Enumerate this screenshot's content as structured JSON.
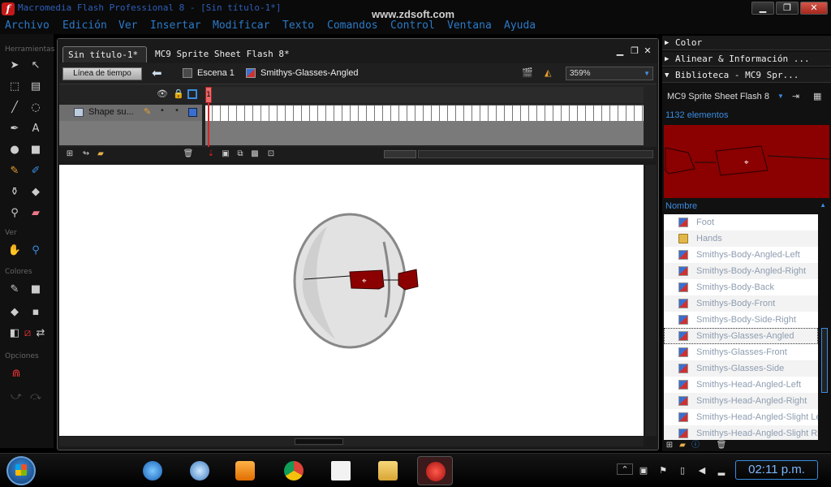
{
  "window": {
    "title": "Macromedia Flash Professional 8 - [Sin título-1*]",
    "watermark": "www.zdsoft.com",
    "min_label": "▁",
    "max_label": "❐",
    "close_label": "✕"
  },
  "menu": [
    "Archivo",
    "Edición",
    "Ver",
    "Insertar",
    "Modificar",
    "Texto",
    "Comandos",
    "Control",
    "Ventana",
    "Ayuda"
  ],
  "tools": {
    "labels": [
      "Herramientas",
      "Ver",
      "Colores",
      "Opciones"
    ]
  },
  "document": {
    "tabs": [
      "Sin título-1*",
      "MC9 Sprite Sheet Flash 8*"
    ],
    "timeline_button": "Línea de tiempo",
    "scene": "Escena 1",
    "symbol": "Smithys-Glasses-Angled",
    "zoom": "359%",
    "layer_name": "Shape su...",
    "frame_number": "1"
  },
  "panels": {
    "color": "Color",
    "align": "Alinear & Información ...",
    "library": "Biblioteca - MC9 Spr...",
    "library_doc": "MC9 Sprite Sheet Flash 8",
    "count": "1132 elementos",
    "column": "Nombre",
    "items": [
      {
        "label": "Foot",
        "type": "symbol"
      },
      {
        "label": "Hands",
        "type": "folder"
      },
      {
        "label": "Smithys-Body-Angled-Left",
        "type": "symbol"
      },
      {
        "label": "Smithys-Body-Angled-Right",
        "type": "symbol"
      },
      {
        "label": "Smithys-Body-Back",
        "type": "symbol"
      },
      {
        "label": "Smithys-Body-Front",
        "type": "symbol"
      },
      {
        "label": "Smithys-Body-Side-Right",
        "type": "symbol"
      },
      {
        "label": "Smithys-Glasses-Angled",
        "type": "symbol"
      },
      {
        "label": "Smithys-Glasses-Front",
        "type": "symbol"
      },
      {
        "label": "Smithys-Glasses-Side",
        "type": "symbol"
      },
      {
        "label": "Smithys-Head-Angled-Left",
        "type": "symbol"
      },
      {
        "label": "Smithys-Head-Angled-Right",
        "type": "symbol"
      },
      {
        "label": "Smithys-Head-Angled-Slight Left",
        "type": "symbol"
      },
      {
        "label": "Smithys-Head-Angled-Slight Right",
        "type": "symbol"
      }
    ],
    "selected_item": "Smithys-Glasses-Angled"
  },
  "taskbar": {
    "clock": "02:11 p.m."
  },
  "colors": {
    "menu_text": "#2a7ac9",
    "glasses": "#8b0000",
    "accent_blue": "#3a8ce0"
  }
}
